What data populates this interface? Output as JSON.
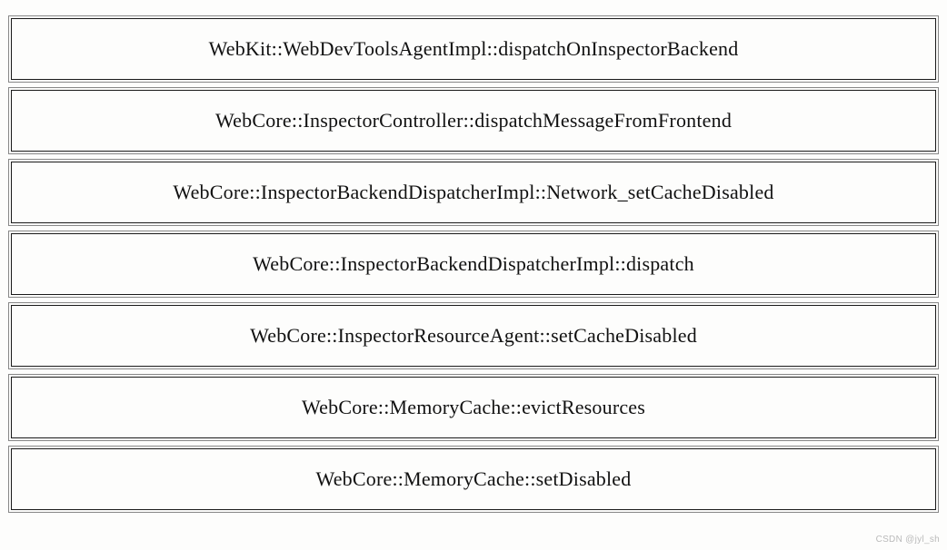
{
  "frames": [
    "WebKit::WebDevToolsAgentImpl::dispatchOnInspectorBackend",
    "WebCore::InspectorController::dispatchMessageFromFrontend",
    "WebCore::InspectorBackendDispatcherImpl::Network_setCacheDisabled",
    "WebCore::InspectorBackendDispatcherImpl::dispatch",
    "WebCore::InspectorResourceAgent::setCacheDisabled",
    "WebCore::MemoryCache::evictResources",
    "WebCore::MemoryCache::setDisabled"
  ],
  "watermark": "CSDN @jyl_sh"
}
